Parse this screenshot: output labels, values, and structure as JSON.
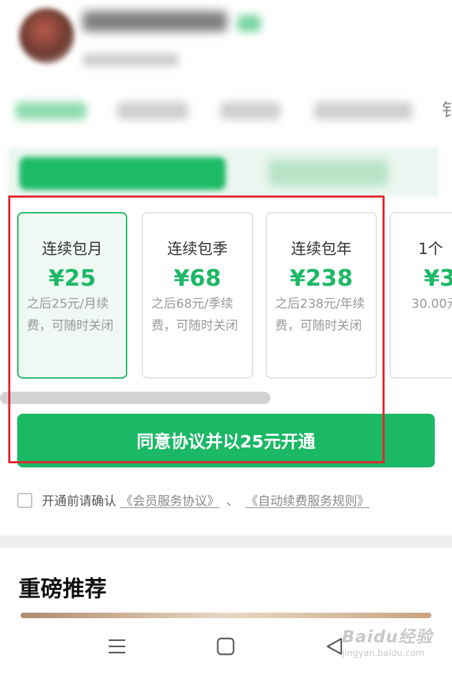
{
  "colors": {
    "accent": "#1bb866",
    "highlight_box": "#e3262d"
  },
  "plans": [
    {
      "title": "连续包月",
      "price": "¥25",
      "desc": "之后25元/月续费，可随时关闭",
      "selected": true
    },
    {
      "title": "连续包季",
      "price": "¥68",
      "desc": "之后68元/季续费，可随时关闭",
      "selected": false
    },
    {
      "title": "连续包年",
      "price": "¥238",
      "desc": "之后238元/年续费，可随时关闭",
      "selected": false
    },
    {
      "title": "1个",
      "price": "¥3",
      "desc": "30.00元",
      "selected": false
    }
  ],
  "cta_label": "同意协议并以25元开通",
  "agreement": {
    "prefix": "开通前请确认",
    "link1": "《会员服务协议》",
    "separator": "、",
    "link2": "《自动续费服务规则》"
  },
  "recommend_title": "重磅推荐",
  "tab_edge_glyph": "钅",
  "nav": {
    "menu_icon": "menu-icon",
    "home_icon": "home-icon",
    "back_icon": "back-icon"
  },
  "watermark": {
    "main": "Baidu经验",
    "sub": "jingyan.baidu.com"
  }
}
